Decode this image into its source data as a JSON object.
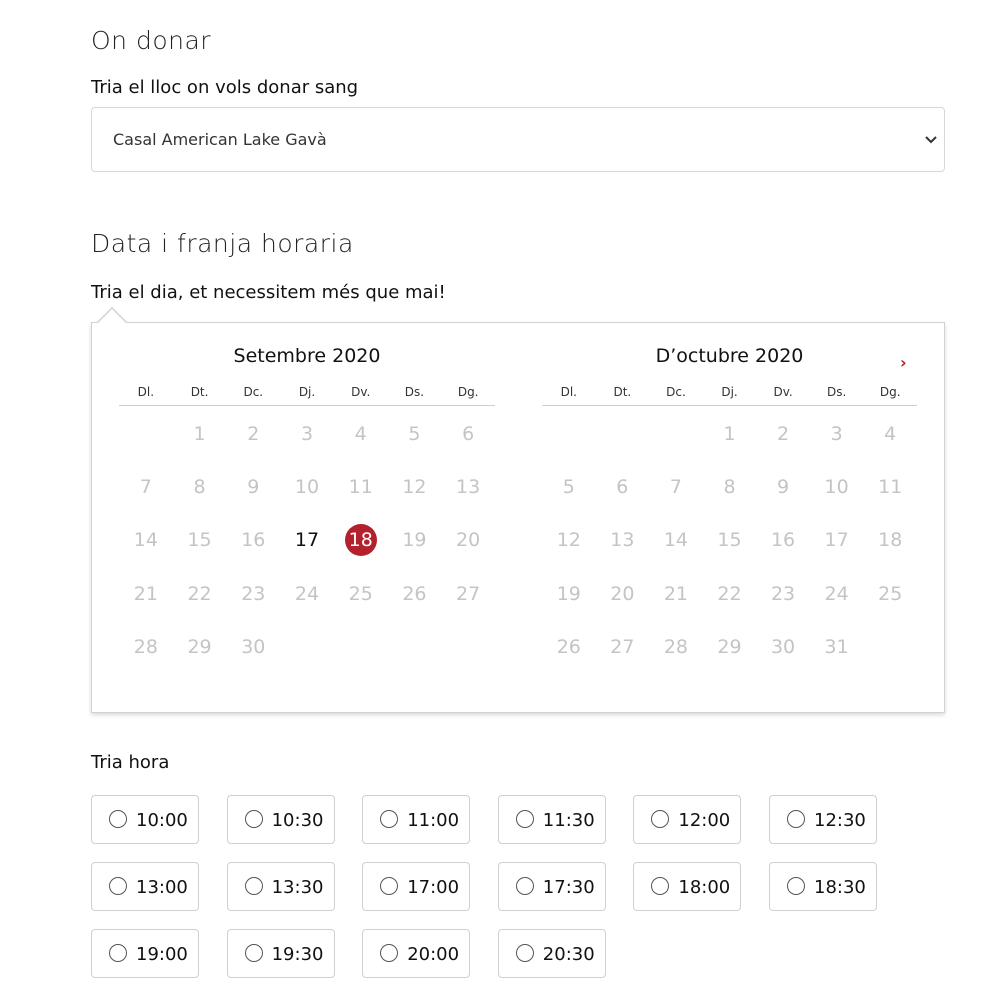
{
  "location": {
    "heading": "On donar",
    "label": "Tria el lloc on vols donar sang",
    "selected": "Casal American Lake Gavà"
  },
  "schedule": {
    "heading": "Data i franja horaria",
    "day_label": "Tria el dia, et necessitem més que mai!",
    "next_arrow": "›",
    "weekdays": [
      "Dl.",
      "Dt.",
      "Dc.",
      "Dj.",
      "Dv.",
      "Ds.",
      "Dg."
    ],
    "months": [
      {
        "title": "Setembre 2020",
        "offset": 1,
        "days": [
          "1",
          "2",
          "3",
          "4",
          "5",
          "6",
          "7",
          "8",
          "9",
          "10",
          "11",
          "12",
          "13",
          "14",
          "15",
          "16",
          "17",
          "18",
          "19",
          "20",
          "21",
          "22",
          "23",
          "24",
          "25",
          "26",
          "27",
          "28",
          "29",
          "30"
        ],
        "active": [
          "17"
        ],
        "selected": "18"
      },
      {
        "title": "D’octubre 2020",
        "offset": 3,
        "days": [
          "1",
          "2",
          "3",
          "4",
          "5",
          "6",
          "7",
          "8",
          "9",
          "10",
          "11",
          "12",
          "13",
          "14",
          "15",
          "16",
          "17",
          "18",
          "19",
          "20",
          "21",
          "22",
          "23",
          "24",
          "25",
          "26",
          "27",
          "28",
          "29",
          "30",
          "31"
        ],
        "active": [],
        "selected": ""
      }
    ],
    "time_label": "Tria hora",
    "times": [
      "10:00",
      "10:30",
      "11:00",
      "11:30",
      "12:00",
      "12:30",
      "13:00",
      "13:30",
      "17:00",
      "17:30",
      "18:00",
      "18:30",
      "19:00",
      "19:30",
      "20:00",
      "20:30"
    ]
  },
  "colors": {
    "accent": "#b3202e",
    "disabled_day": "#c4c4c4"
  }
}
